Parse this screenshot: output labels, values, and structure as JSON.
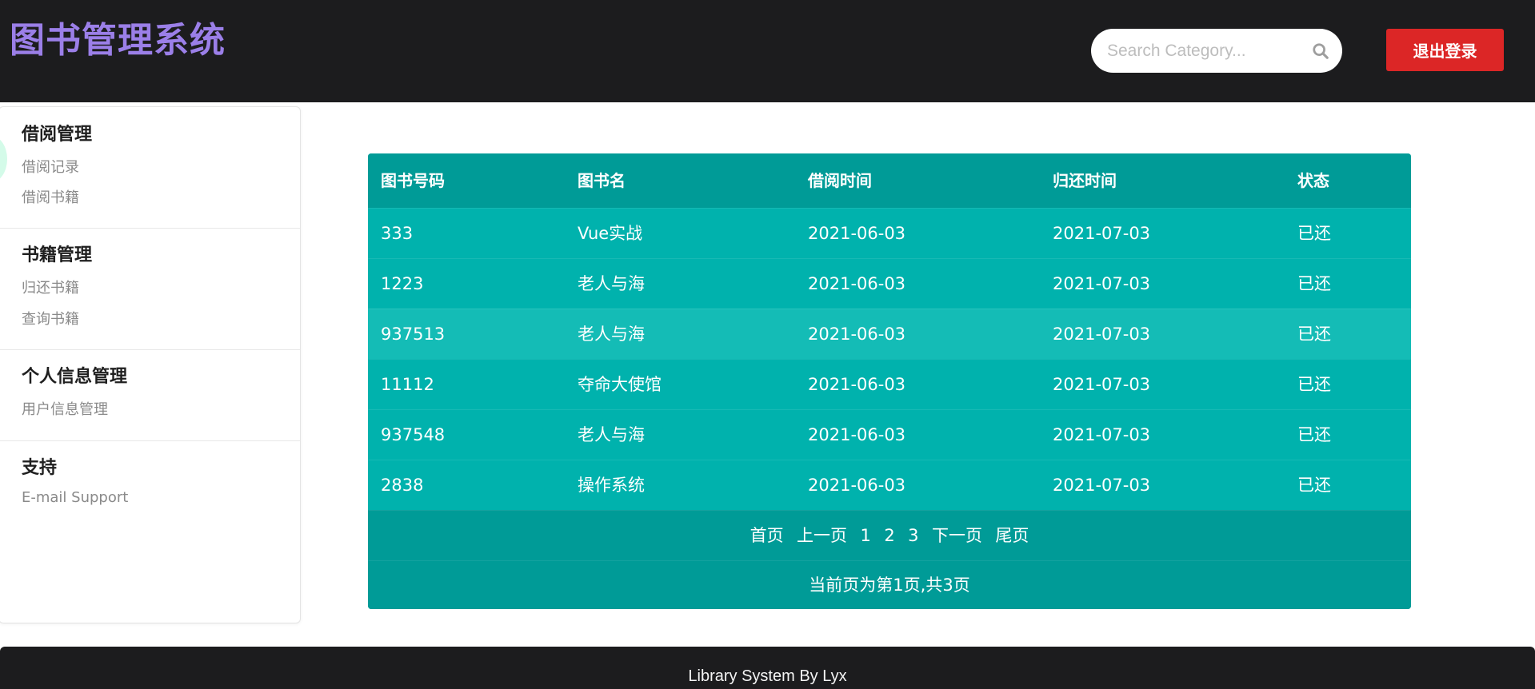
{
  "header": {
    "title": "图书管理系统",
    "search_placeholder": "Search Category...",
    "search_icon": "search-icon",
    "logout_label": "退出登录"
  },
  "sidebar": {
    "sections": [
      {
        "title": "借阅管理",
        "items": [
          "借阅记录",
          "借阅书籍"
        ]
      },
      {
        "title": "书籍管理",
        "items": [
          "归还书籍",
          "查询书籍"
        ]
      },
      {
        "title": "个人信息管理",
        "items": [
          "用户信息管理"
        ]
      },
      {
        "title": "支持",
        "items": [
          "E-mail Support"
        ]
      }
    ]
  },
  "table": {
    "headers": [
      "图书号码",
      "图书名",
      "借阅时间",
      "归还时间",
      "状态"
    ],
    "rows": [
      [
        "333",
        "Vue实战",
        "2021-06-03",
        "2021-07-03",
        "已还"
      ],
      [
        "1223",
        "老人与海",
        "2021-06-03",
        "2021-07-03",
        "已还"
      ],
      [
        "937513",
        "老人与海",
        "2021-06-03",
        "2021-07-03",
        "已还"
      ],
      [
        "11112",
        "夺命大使馆",
        "2021-06-03",
        "2021-07-03",
        "已还"
      ],
      [
        "937548",
        "老人与海",
        "2021-06-03",
        "2021-07-03",
        "已还"
      ],
      [
        "2838",
        "操作系统",
        "2021-06-03",
        "2021-07-03",
        "已还"
      ]
    ],
    "highlighted_row": 2
  },
  "pagination": {
    "first": "首页",
    "prev": "上一页",
    "pages": [
      "1",
      "2",
      "3"
    ],
    "next": "下一页",
    "last": "尾页",
    "info": "当前页为第1页,共3页"
  },
  "footer": {
    "text": "Library System By Lyx"
  },
  "colors": {
    "header_bg": "#1c1c1e",
    "title": "#9b7fe8",
    "logout": "#dc2626",
    "table_row": "#00b2ad",
    "table_header": "#009b97",
    "table_highlight": "#14bcb6"
  }
}
